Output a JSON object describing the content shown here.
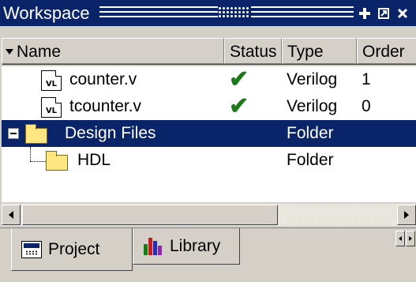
{
  "window": {
    "title": "Workspace"
  },
  "columns": [
    "Name",
    "Status",
    "Type",
    "Order"
  ],
  "rows": [
    {
      "icon": "verilog-file-icon",
      "badge": "VL",
      "name": "counter.v",
      "status_icon": "checkmark-icon",
      "status": "✔",
      "type": "Verilog",
      "order": "1",
      "selected": false
    },
    {
      "icon": "verilog-file-icon",
      "badge": "VL",
      "name": "tcounter.v",
      "status_icon": "checkmark-icon",
      "status": "✔",
      "type": "Verilog",
      "order": "0",
      "selected": false
    },
    {
      "icon": "folder-icon",
      "name": "Design Files",
      "status": "",
      "type": "Folder",
      "order": "",
      "selected": true,
      "expanded": true
    },
    {
      "icon": "folder-icon",
      "name": "HDL",
      "status": "",
      "type": "Folder",
      "order": "",
      "selected": false
    }
  ],
  "tabs": [
    {
      "label": "Project",
      "icon": "project-icon",
      "active": true
    },
    {
      "label": "Library",
      "icon": "library-icon",
      "active": false
    }
  ],
  "titlebar_buttons": [
    "dock-icon",
    "maximize-icon",
    "close-icon"
  ],
  "colors": {
    "titlebar": "#0a246a",
    "selection": "#0a246a",
    "face": "#d4d0c8",
    "check": "#1c7a1c",
    "folder": "#ffe680"
  }
}
